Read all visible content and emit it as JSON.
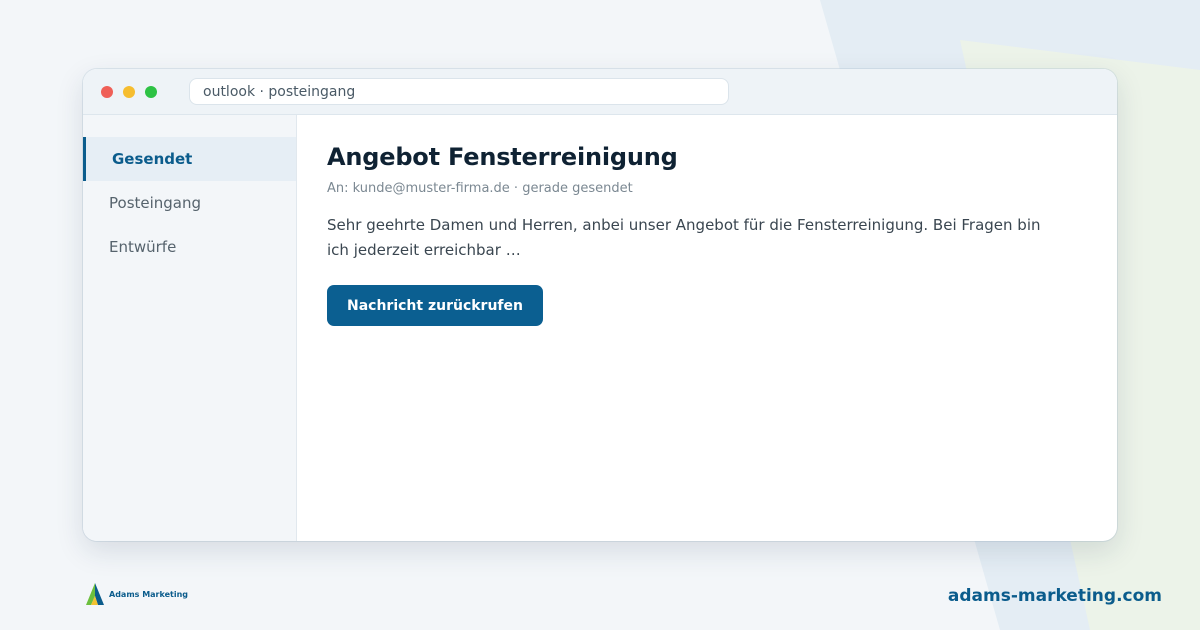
{
  "browser": {
    "address": "outlook · posteingang"
  },
  "sidebar": {
    "items": [
      {
        "label": "Gesendet",
        "active": true
      },
      {
        "label": "Posteingang",
        "active": false
      },
      {
        "label": "Entwürfe",
        "active": false
      }
    ]
  },
  "email": {
    "subject": "Angebot Fensterreinigung",
    "meta": "An: kunde@muster-firma.de · gerade gesendet",
    "body": "Sehr geehrte Damen und Herren, anbei unser Angebot für die Fensterreinigung. Bei Fragen bin ich jederzeit erreichbar …",
    "recall_button": "Nachricht zurückrufen"
  },
  "footer": {
    "logo_text": "Adams Marketing",
    "website": "adams-marketing.com"
  },
  "colors": {
    "accent": "#0b5f91",
    "background": "#f3f6f9"
  }
}
